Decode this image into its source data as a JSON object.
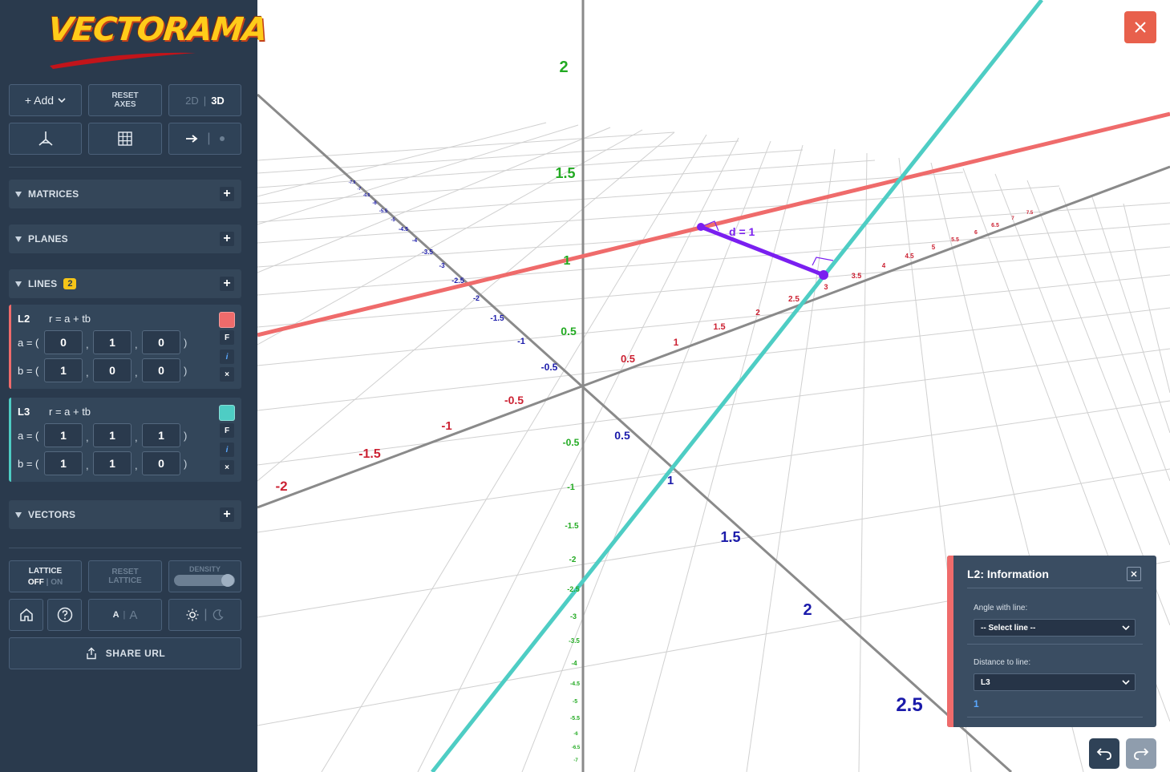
{
  "app": {
    "logo": "VECTORAMA"
  },
  "toolbar": {
    "add_label": "+ Add",
    "reset_axes_line1": "RESET",
    "reset_axes_line2": "AXES",
    "mode_2d": "2D",
    "mode_3d": "3D"
  },
  "sections": {
    "matrices": "MATRICES",
    "planes": "PLANES",
    "lines": "LINES",
    "lines_count": "2",
    "vectors": "VECTORS"
  },
  "lines": [
    {
      "name": "L2",
      "equation": "r = a + tb",
      "a": [
        "0",
        "1",
        "0"
      ],
      "b": [
        "1",
        "0",
        "0"
      ],
      "color": "#ef6b6b"
    },
    {
      "name": "L3",
      "equation": "r = a + tb",
      "a": [
        "1",
        "1",
        "1"
      ],
      "b": [
        "1",
        "1",
        "0"
      ],
      "color": "#4ecdc4"
    }
  ],
  "line_labels": {
    "a": "a = (",
    "b": "b = (",
    "close": ")",
    "comma": ",",
    "flag_f": "F",
    "flag_i": "i",
    "flag_x": "×"
  },
  "bottom": {
    "lattice": "LATTICE",
    "lattice_off": "OFF",
    "lattice_on": "ON",
    "reset_lattice_line1": "RESET",
    "reset_lattice_line2": "LATTICE",
    "density": "DENSITY",
    "font_small": "A",
    "font_large": "A",
    "share_url": "SHARE URL"
  },
  "info_panel": {
    "title": "L2: Information",
    "angle_label": "Angle with line:",
    "angle_value": "-- Select line --",
    "distance_label": "Distance to line:",
    "distance_select": "L3",
    "distance_value": "1"
  },
  "scene": {
    "distance_annotation": "d = 1",
    "labels_y_green": [
      "2",
      "1.5",
      "1",
      "0.5",
      "-0.5",
      "-1",
      "-1.5",
      "-2",
      "-2.5",
      "-3",
      "-3.5",
      "-4",
      "-4.5",
      "-5",
      "-5.5",
      "-6",
      "-6.5",
      "-7"
    ],
    "labels_x_red_near": [
      "0.5",
      "1",
      "1.5",
      "2",
      "2.5",
      "3",
      "3.5",
      "4",
      "4.5",
      "5",
      "5.5",
      "6",
      "6.5",
      "7",
      "7.5"
    ],
    "labels_x_red_neg": [
      "-0.5",
      "-1",
      "-1.5",
      "-2"
    ],
    "labels_z_blue_neg": [
      "-0.5",
      "-1",
      "-1.5",
      "-2",
      "-2.5",
      "-3",
      "-3.5",
      "-4",
      "-4.5",
      "-5",
      "-5.5",
      "-6",
      "-6.5",
      "-7",
      "-7.5"
    ],
    "labels_z_blue_pos": [
      "0.5",
      "1",
      "1.5",
      "2",
      "2.5"
    ],
    "colors": {
      "x_axis": "#cc2233",
      "y_axis": "#22aa22",
      "z_axis": "#1a1aaa",
      "l2": "#ef6b6b",
      "l3": "#4ecdc4",
      "distance": "#7a1ff0"
    }
  }
}
